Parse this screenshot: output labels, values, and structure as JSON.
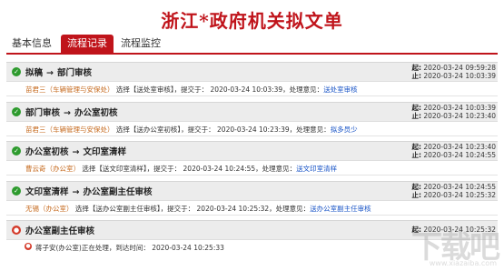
{
  "title": "浙江*政府机关拟文单",
  "tabs": [
    {
      "label": "基本信息"
    },
    {
      "label": "流程记录"
    },
    {
      "label": "流程监控"
    }
  ],
  "steps": [
    {
      "from": "拟稿",
      "to": "部门审核",
      "start_label": "起:",
      "start": "2020-03-24 09:59:28",
      "end_label": "止:",
      "end": "2020-03-24 10:03:39",
      "who": "苗君三（车辆管理与安保处）",
      "action": "选择【送处室审核】，提交于： 2020-03-24 10:03:39，处理意见：",
      "opinion": "送处室审核"
    },
    {
      "from": "部门审核",
      "to": "办公室初核",
      "start_label": "起:",
      "start": "2020-03-24 10:03:39",
      "end_label": "止:",
      "end": "2020-03-24 10:23:40",
      "who": "苗君三（车辆管理与安保处）",
      "action": "选择【送办公室初核】，提交于： 2020-03-24 10:23:39，处理意见：",
      "opinion": "拟多员少"
    },
    {
      "from": "办公室初核",
      "to": "文印室清样",
      "start_label": "起:",
      "start": "2020-03-24 10:23:40",
      "end_label": "止:",
      "end": "2020-03-24 10:24:55",
      "who": "曹云奇（办公室）",
      "action": "选择【送文印室清样】，提交于： 2020-03-24 10:24:55，处理意见：",
      "opinion": "送文印室清样"
    },
    {
      "from": "文印室清样",
      "to": "办公室副主任审核",
      "start_label": "起:",
      "start": "2020-03-24 10:24:55",
      "end_label": "止:",
      "end": "2020-03-24 10:25:32",
      "who": "无锡（办公室）",
      "action": "选择【送办公室副主任审核】，提交于： 2020-03-24 10:25:32，处理意见：",
      "opinion": "送办公室副主任审核"
    }
  ],
  "current": {
    "name": "办公室副主任审核",
    "start_label": "起:",
    "start": "2020-03-24 10:25:32",
    "status": "蒋子安(办公室)正在处理，到达时间： 2020-03-24 10:25:33"
  },
  "icons": {
    "done": "check-circle-icon",
    "active": "dot-circle-icon"
  },
  "colors": {
    "brand": "#c0141b",
    "done": "#2e9b2e",
    "link": "#1a55c7",
    "person": "#c66a1e"
  },
  "watermark": {
    "logo": "下载吧",
    "url": "www.xiazaiba.com"
  }
}
